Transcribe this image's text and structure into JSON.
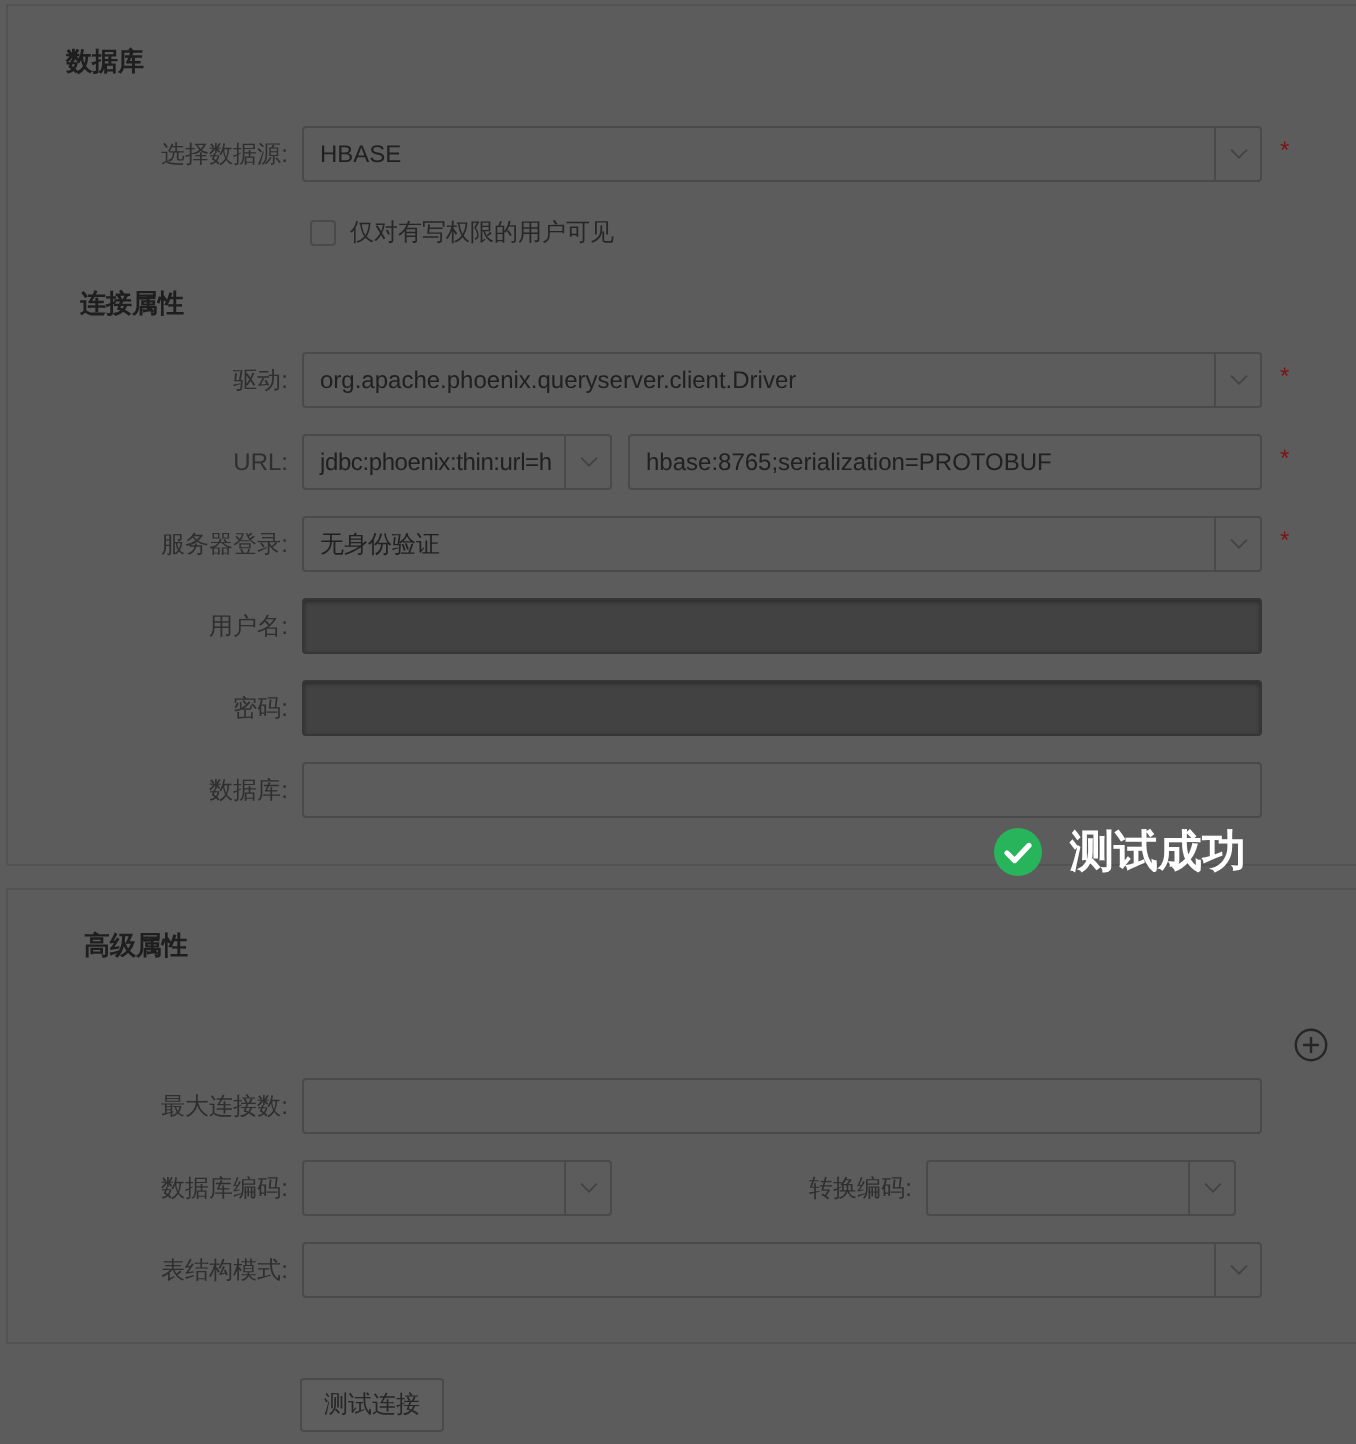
{
  "database_section": {
    "title": "数据库",
    "source": {
      "label": "选择数据源:",
      "value": "HBASE",
      "required_mark": "*"
    },
    "write_only": {
      "label": "仅对有写权限的用户可见",
      "checked": false
    },
    "connection_title": "连接属性",
    "fields": [
      {
        "kind": "select",
        "label": "驱动:",
        "value": "org.apache.phoenix.queryserver.client.Driver",
        "required_mark": "*"
      },
      {
        "kind": "split",
        "label": "URL:",
        "left_value": "jdbc:phoenix:thin:url=h",
        "right_value": "hbase:8765;serialization=PROTOBUF",
        "required_mark": "*"
      },
      {
        "kind": "select",
        "label": "服务器登录:",
        "value": "无身份验证",
        "required_mark": "*"
      },
      {
        "kind": "input",
        "label": "用户名:",
        "disabled": true
      },
      {
        "kind": "input",
        "label": "密码:",
        "disabled": true
      },
      {
        "kind": "input",
        "label": "数据库:",
        "disabled": false
      }
    ]
  },
  "toast": {
    "text": "测试成功"
  },
  "advanced_section": {
    "title": "高级属性",
    "fields": [
      {
        "kind": "input",
        "label": "最大连接数:",
        "disabled": false
      },
      {
        "kind": "pair",
        "items": [
          {
            "label": "数据库编码:"
          },
          {
            "label": "转换编码:"
          }
        ]
      },
      {
        "kind": "select",
        "label": "表结构模式:"
      }
    ]
  },
  "test_button": "测试连接"
}
